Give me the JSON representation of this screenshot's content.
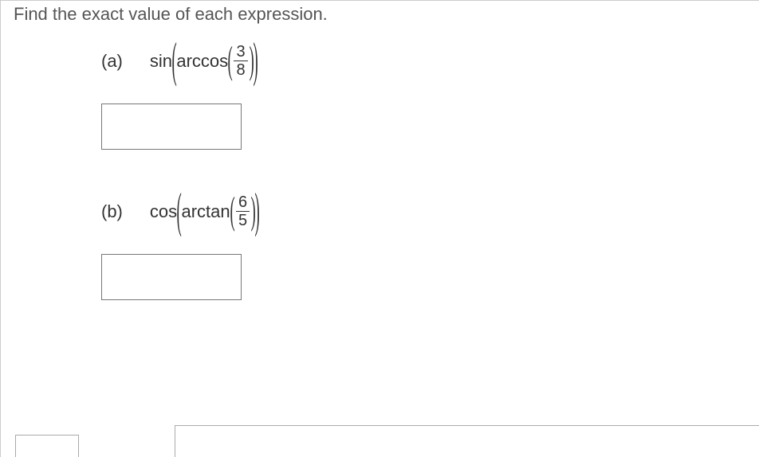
{
  "instruction": "Find the exact value of each expression.",
  "problems": [
    {
      "part": "(a)",
      "outer_func": "sin",
      "inner_func": "arccos",
      "frac_num": "3",
      "frac_den": "8"
    },
    {
      "part": "(b)",
      "outer_func": "cos",
      "inner_func": "arctan",
      "frac_num": "6",
      "frac_den": "5"
    }
  ]
}
